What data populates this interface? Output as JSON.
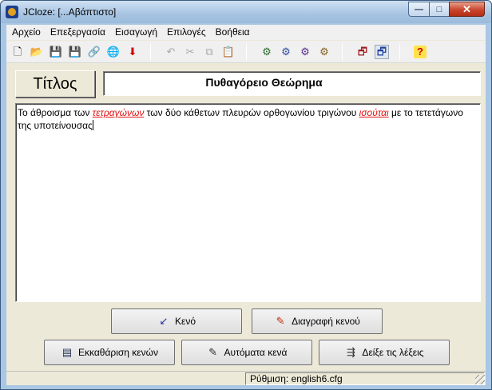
{
  "window": {
    "title": "JCloze: [...Αβάπτιστο]",
    "minimize_glyph": "—",
    "maximize_glyph": "□",
    "close_glyph": "✕"
  },
  "menu": [
    "Αρχείο",
    "Επεξεργασία",
    "Εισαγωγή",
    "Επιλογές",
    "Βοήθεια"
  ],
  "toolbar_icons": {
    "new": "🗋",
    "open": "📂",
    "save": "💾",
    "save_as": "💾",
    "export": "🔗",
    "web_export": "🌐",
    "down_arrow": "⬇",
    "undo": "↶",
    "cut": "✂",
    "copy": "⧉",
    "paste": "📋",
    "config1": "⚙",
    "config2": "⚙",
    "config3": "⚙",
    "config4": "⚙",
    "view1": "🗗",
    "view2": "🗗",
    "help": "?"
  },
  "title_label": "Τίτλος",
  "title_value": "Πυθαγόρειο Θεώρημα",
  "editor": {
    "seg1": "Το άθροισμα των ",
    "gap1": "τετραγώνων",
    "seg2": " των δύο κάθετων πλευρών ορθογωνίου τριγώνου ",
    "gap2": "ισούται",
    "seg3": " με το τετετάγωνο της υποτείνουσας"
  },
  "buttons": {
    "gap": "Κενό",
    "delete_gap": "Διαγραφή κενού",
    "clear_gaps": "Εκκαθάριση κενών",
    "auto_gaps": "Αυτόματα κενά",
    "show_words": "Δείξε τις λέξεις"
  },
  "button_icons": {
    "gap": "↙",
    "delete_gap": "✎",
    "clear_gaps": "▤",
    "auto_gaps": "✎",
    "show_words": "⇶"
  },
  "status": "Ρύθμιση: english6.cfg",
  "colors": {
    "gap_word": "#e01010",
    "window_frame": "#a9c6e4",
    "close_button": "#c9452c"
  }
}
